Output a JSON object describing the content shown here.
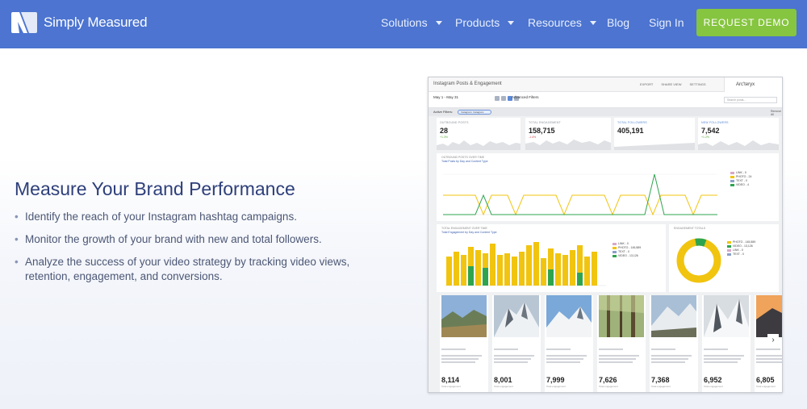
{
  "nav": {
    "brand": "Simply Measured",
    "items": [
      {
        "label": "Solutions",
        "dropdown": true
      },
      {
        "label": "Products",
        "dropdown": true
      },
      {
        "label": "Resources",
        "dropdown": true
      },
      {
        "label": "Blog",
        "dropdown": false
      },
      {
        "label": "Sign In",
        "dropdown": false
      }
    ],
    "cta": "REQUEST DEMO"
  },
  "hero": {
    "headline": "Measure Your Brand Performance",
    "bullets": [
      "Identify the reach of your Instagram hashtag campaigns.",
      "Monitor the growth of your brand with new and total followers.",
      "Analyze the success of your video strategy by tracking video views, retention, engagement, and conversions."
    ]
  },
  "dashboard": {
    "title": "Instagram Posts & Engagement",
    "top_links": [
      "EXPORT",
      "SHARE VIEW",
      "SETTINGS"
    ],
    "brand": "Arc'teryx",
    "date_range": "May 1 - May 31",
    "advanced_filters": "Advanced Filters",
    "search_placeholder": "Search posts...",
    "active_filters_label": "Active Filters:",
    "active_filter_chip": "Instagram: Instagram",
    "remove_all": "Remove All",
    "stats": [
      {
        "label": "OUTBOUND POSTS",
        "value": "28",
        "delta": "+1.3%",
        "delta_color": "green"
      },
      {
        "label": "TOTAL ENGAGEMENT",
        "value": "158,715",
        "delta": "-1.4%",
        "delta_color": "red"
      },
      {
        "label": "TOTAL FOLLOWERS",
        "value": "405,191",
        "delta": "",
        "delta_color": "green"
      },
      {
        "label": "NEW FOLLOWERS",
        "value": "7,542",
        "delta": "+1.2%",
        "delta_color": "green"
      }
    ],
    "posts_chart": {
      "title": "OUTBOUND POSTS OVER TIME",
      "subtitle": "Total Posts by Day and Content Type",
      "legend": [
        {
          "label": "LINK - 0",
          "color": "#d8a8c6"
        },
        {
          "label": "PHOTO - 24",
          "color": "#f1c40f"
        },
        {
          "label": "TEXT - 0",
          "color": "#8aa0c8"
        },
        {
          "label": "VIDEO - 4",
          "color": "#2ea44f"
        }
      ]
    },
    "engagement_chart": {
      "title": "TOTAL ENGAGEMENT OVER TIME",
      "subtitle": "Total Engagement by Day and Content Type",
      "legend": [
        {
          "label": "LINK - 0",
          "color": "#d8a8c6"
        },
        {
          "label": "PHOTO - 145,589",
          "color": "#f1c40f"
        },
        {
          "label": "TEXT - 0",
          "color": "#8aa0c8"
        },
        {
          "label": "VIDEO - 13,126",
          "color": "#2ea44f"
        }
      ]
    },
    "totals_chart": {
      "title": "ENGAGEMENT TOTALS",
      "legend": [
        {
          "label": "PHOTO - 145,589",
          "color": "#f1c40f"
        },
        {
          "label": "VIDEO - 13,126",
          "color": "#2ea44f"
        },
        {
          "label": "LINK - 0",
          "color": "#d8a8c6"
        },
        {
          "label": "TEXT - 0",
          "color": "#8aa0c8"
        }
      ]
    },
    "posts": [
      {
        "engagement": "8,114",
        "caption": "Total engagement"
      },
      {
        "engagement": "8,001",
        "caption": "Total engagement"
      },
      {
        "engagement": "7,999",
        "caption": "Total engagement"
      },
      {
        "engagement": "7,626",
        "caption": "Total engagement"
      },
      {
        "engagement": "7,368",
        "caption": "Total engagement"
      },
      {
        "engagement": "6,952",
        "caption": "Total engagement"
      },
      {
        "engagement": "6,805",
        "caption": "Total engagement"
      }
    ],
    "next_icon": "chevron-right-icon"
  }
}
